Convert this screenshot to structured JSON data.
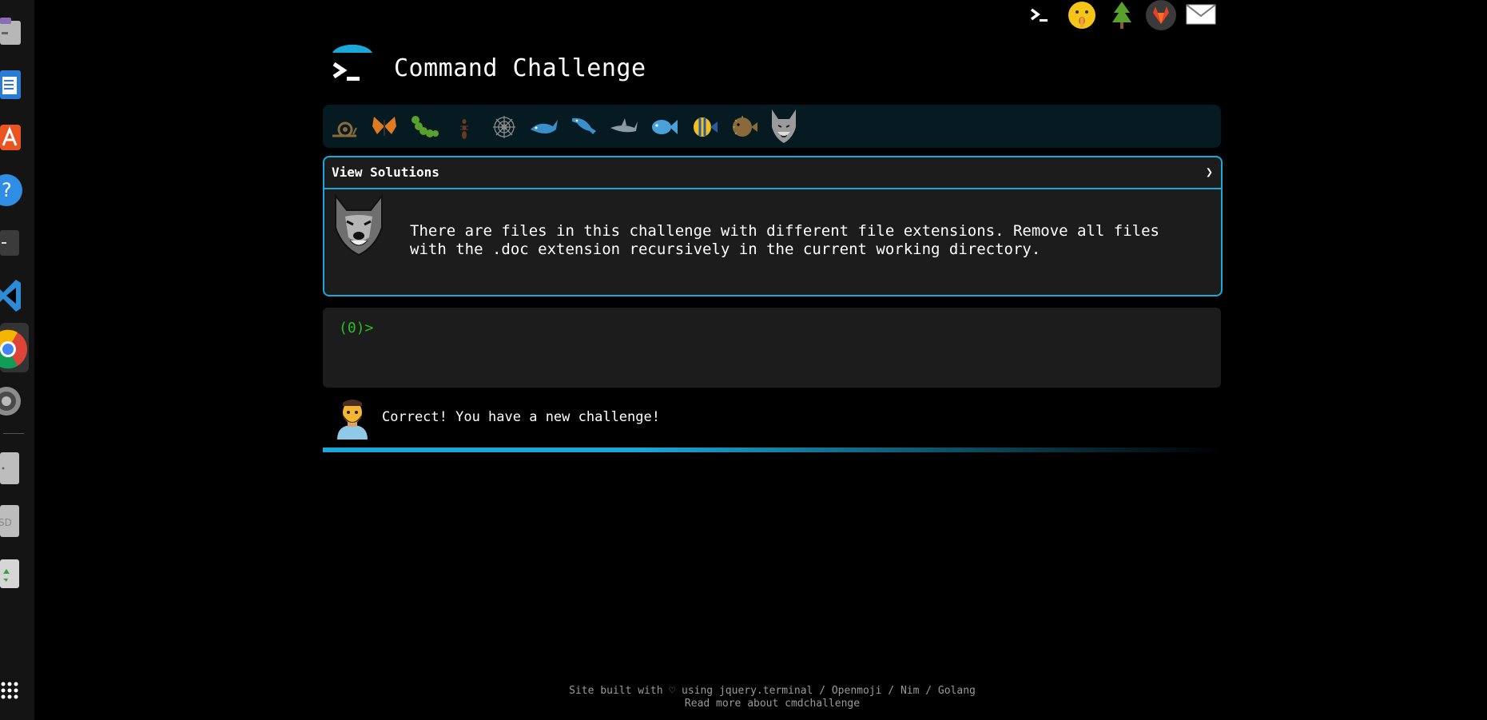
{
  "site": {
    "title": "Command Challenge"
  },
  "level_icons": [
    {
      "name": "snail-icon",
      "color": "#8a6a3a"
    },
    {
      "name": "butterfly-icon",
      "color": "#e07a20"
    },
    {
      "name": "caterpillar-icon",
      "color": "#5aa02c"
    },
    {
      "name": "ant-icon",
      "color": "#6b3a1a"
    },
    {
      "name": "spider-web-icon",
      "color": "#8c8c8c"
    },
    {
      "name": "whale-icon",
      "color": "#3a8fc8"
    },
    {
      "name": "dolphin-icon",
      "color": "#3a8fc8"
    },
    {
      "name": "shark-icon",
      "color": "#8c9aa4"
    },
    {
      "name": "fish-icon",
      "color": "#4aa0d8"
    },
    {
      "name": "tropical-fish-icon",
      "color": "#f0c020"
    },
    {
      "name": "pufferfish-icon",
      "color": "#8a6a3a"
    },
    {
      "name": "wolf-icon",
      "color": "#9a9a9a"
    }
  ],
  "challenge": {
    "solutions_label": "View Solutions",
    "chevron": "❯",
    "avatar_icon": "wolf-icon",
    "text": "There are files in this challenge with different file extensions. Remove all files\nwith the .doc extension recursively in the current working directory."
  },
  "terminal": {
    "prompt": "(0)>"
  },
  "feedback": {
    "text": "Correct! You have a new challenge!",
    "progress_percent": 100
  },
  "footer": {
    "line1": "Site built with ♡ using jquery.terminal / Openmoji / Nim / Golang",
    "line2": "Read more about cmdchallenge"
  },
  "top_icons": [
    "terminal-icon",
    "shushing-face-icon",
    "tree-icon",
    "gitlab-icon",
    "mail-icon"
  ],
  "dock_icons": [
    "files-icon",
    "writer-icon",
    "app-center-icon",
    "help-icon",
    "terminal-app-icon",
    "vscode-icon",
    "chrome-icon",
    "settings-icon",
    "drive-icon",
    "ssd-icon",
    "trash-icon",
    "apps-grid-icon"
  ],
  "colors": {
    "accent": "#1aa7d9",
    "prompt": "#26c026",
    "card_bg": "#1c1c1c",
    "bar_bg": "#061a22"
  }
}
